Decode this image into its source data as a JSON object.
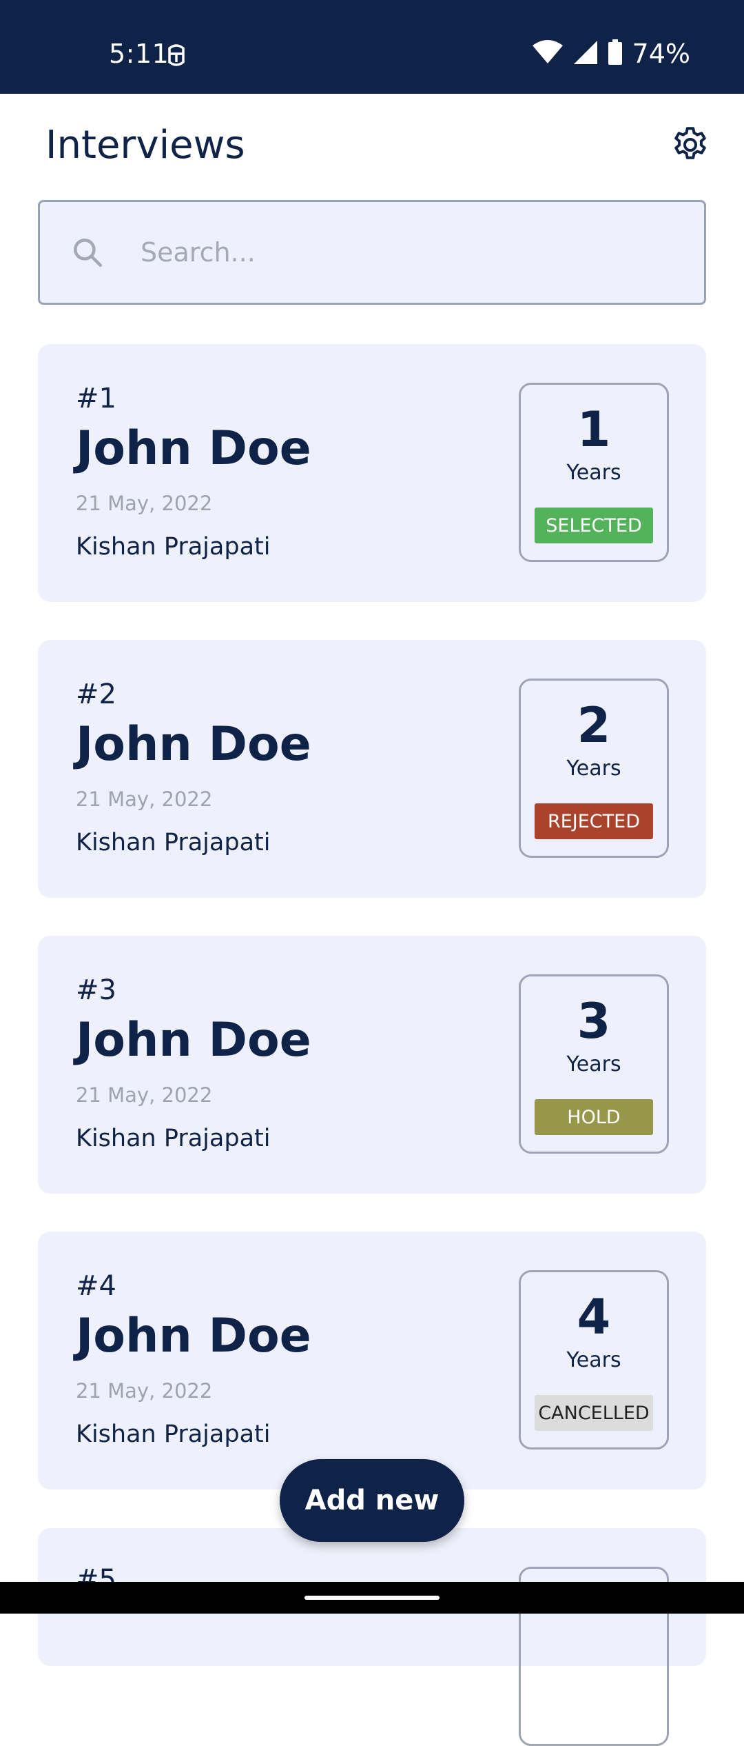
{
  "status_bar": {
    "time": "5:11",
    "battery_percent": "74%",
    "icons": [
      "android-debug-icon",
      "wifi-icon",
      "cell-signal-icon",
      "battery-icon"
    ]
  },
  "header": {
    "title": "Interviews",
    "settings_icon": "gear-icon"
  },
  "search": {
    "placeholder": "Search...",
    "value": ""
  },
  "interviews": [
    {
      "number": "#1",
      "name": "John Doe",
      "date": "21 May, 2022",
      "interviewer": "Kishan Prajapati",
      "experience": "1",
      "experience_unit": "Years",
      "status": "SELECTED"
    },
    {
      "number": "#2",
      "name": "John Doe",
      "date": "21 May, 2022",
      "interviewer": "Kishan Prajapati",
      "experience": "2",
      "experience_unit": "Years",
      "status": "REJECTED"
    },
    {
      "number": "#3",
      "name": "John Doe",
      "date": "21 May, 2022",
      "interviewer": "Kishan Prajapati",
      "experience": "3",
      "experience_unit": "Years",
      "status": "HOLD"
    },
    {
      "number": "#4",
      "name": "John Doe",
      "date": "21 May, 2022",
      "interviewer": "Kishan Prajapati",
      "experience": "4",
      "experience_unit": "Years",
      "status": "CANCELLED"
    },
    {
      "number": "#5"
    }
  ],
  "status_colors": {
    "SELECTED": "#54b25b",
    "REJECTED": "#a9432b",
    "HOLD": "#97974a",
    "CANCELLED": "#dcdcdc"
  },
  "fab": {
    "label": "Add new"
  },
  "colors": {
    "primary": "#0f2248",
    "card_background": "#eef1fb"
  }
}
